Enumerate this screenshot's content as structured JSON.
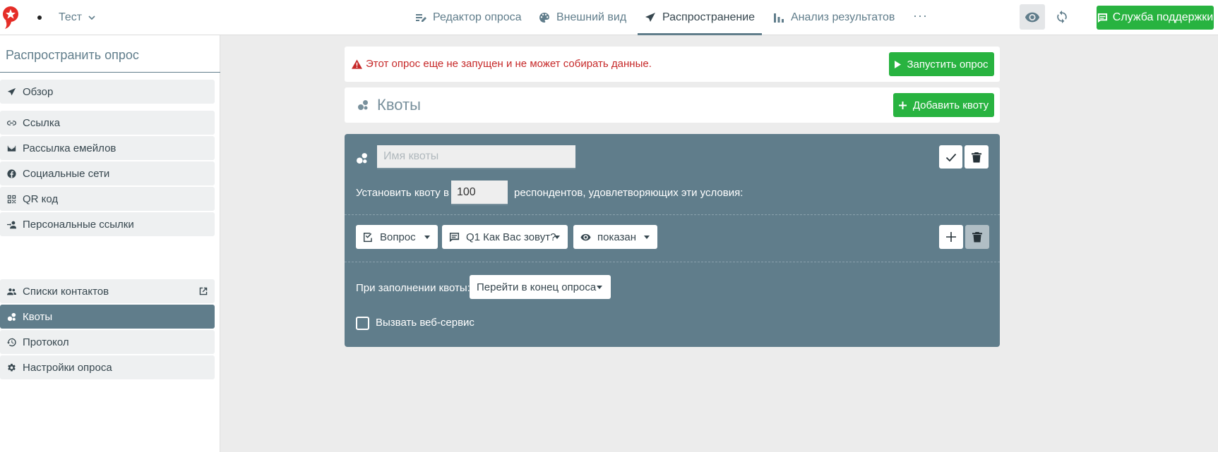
{
  "topbar": {
    "project_name": "Тест",
    "nav": [
      {
        "label": "Редактор опроса",
        "icon": "edit-list-icon"
      },
      {
        "label": "Внешний вид",
        "icon": "palette-icon"
      },
      {
        "label": "Распространение",
        "icon": "paper-plane-icon"
      },
      {
        "label": "Анализ результатов",
        "icon": "bar-chart-icon"
      }
    ],
    "active_nav": "Распространение",
    "more_label": "···",
    "support_label": "Служба поддержки"
  },
  "sidebar": {
    "title": "Распространить опрос",
    "items": [
      {
        "label": "Обзор",
        "icon": "paper-plane-icon"
      },
      {
        "label": "Ссылка",
        "icon": "link-icon"
      },
      {
        "label": "Рассылка емейлов",
        "icon": "envelope-icon"
      },
      {
        "label": "Социальные сети",
        "icon": "facebook-icon"
      },
      {
        "label": "QR код",
        "icon": "qr-code-icon"
      },
      {
        "label": "Персональные ссылки",
        "icon": "person-link-icon"
      },
      {
        "label": "Списки контактов",
        "icon": "contacts-icon"
      },
      {
        "label": "Квоты",
        "icon": "quota-icon"
      },
      {
        "label": "Протокол",
        "icon": "history-icon"
      },
      {
        "label": "Настройки опроса",
        "icon": "gear-icon"
      }
    ],
    "active_item": "Квоты"
  },
  "alert": {
    "text": "Этот опрос еще не запущен и не может собирать данные.",
    "start_label": "Запустить опрос"
  },
  "quotas": {
    "title": "Квоты",
    "add_label": "Добавить квоту"
  },
  "quota_card": {
    "name_placeholder": "Имя квоты",
    "name_value": "",
    "set_label": "Установить квоту в",
    "count_value": "100",
    "respondents_label": "респондентов, удовлетворяющих эти условия:",
    "condition": {
      "type_label": "Вопрос",
      "question_label": "Q1 Как Вас зовут?",
      "state_label": "показан"
    },
    "on_fill_label": "При заполнении квоты:",
    "on_fill_action": "Перейти в конец опроса",
    "webservice_label": "Вызвать веб-сервис",
    "webservice_checked": false
  },
  "colors": {
    "accent": "#607d8b",
    "green": "#28b340",
    "alert_red": "#c62828",
    "background": "#ececec"
  }
}
